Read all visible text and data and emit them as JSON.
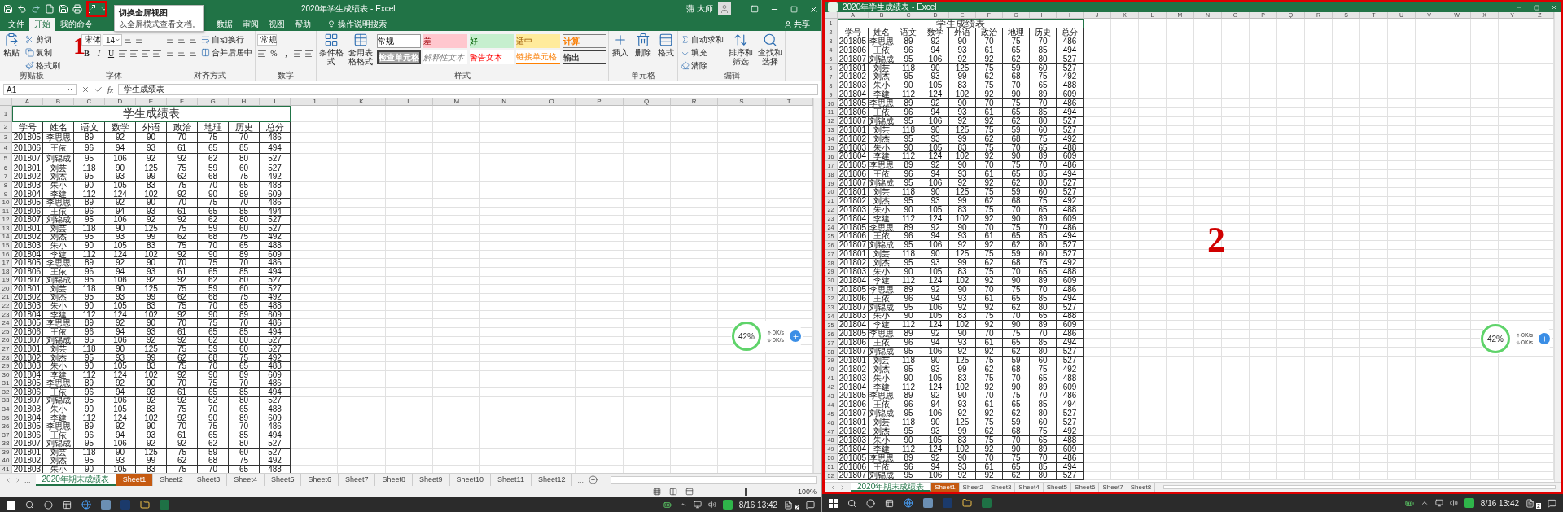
{
  "left_window": {
    "title": "2020年学生成绩表 - Excel",
    "user": "蒲 大师",
    "ribbon_tabs": [
      {
        "label": "文件",
        "selected": false
      },
      {
        "label": "开始",
        "selected": true
      },
      {
        "label": "我的命令",
        "selected": false
      },
      {
        "label": "数据",
        "selected": false
      },
      {
        "label": "审阅",
        "selected": false
      },
      {
        "label": "视图",
        "selected": false
      },
      {
        "label": "帮助",
        "selected": false
      }
    ],
    "tell_me": "操作说明搜索",
    "share": "共享",
    "tooltip": {
      "title": "切换全屏视图",
      "text": "以全屏模式查看文档。"
    },
    "ribbon_groups": [
      {
        "label": "剪贴板",
        "large": [
          {
            "kind": "large",
            "label": "粘贴"
          }
        ],
        "lines": [
          [
            {
              "kind": "small",
              "label": "剪切"
            }
          ],
          [
            {
              "kind": "small",
              "label": "复制"
            }
          ],
          [
            {
              "kind": "small",
              "label": "格式刷"
            }
          ]
        ]
      },
      {
        "label": "字体",
        "lines": [
          [
            {
              "kind": "select",
              "label": "宋体"
            },
            {
              "kind": "select",
              "label": "14"
            },
            {
              "kind": "icon"
            },
            {
              "kind": "icon"
            }
          ],
          [
            {
              "kind": "bold",
              "label": "B"
            },
            {
              "kind": "italic",
              "label": "I"
            },
            {
              "kind": "underline",
              "label": "U"
            },
            {
              "kind": "icon"
            },
            {
              "kind": "icon"
            },
            {
              "kind": "icon"
            },
            {
              "kind": "icon"
            }
          ]
        ]
      },
      {
        "label": "对齐方式",
        "lines": [
          [
            {
              "kind": "icon"
            },
            {
              "kind": "icon"
            },
            {
              "kind": "icon"
            },
            {
              "kind": "small",
              "label": "自动换行"
            }
          ],
          [
            {
              "kind": "icon"
            },
            {
              "kind": "icon"
            },
            {
              "kind": "icon"
            },
            {
              "kind": "small",
              "label": "合并后居中"
            }
          ]
        ]
      },
      {
        "label": "数字",
        "lines": [
          [
            {
              "kind": "select",
              "label": "常规"
            }
          ],
          [
            {
              "kind": "icon"
            },
            {
              "kind": "char",
              "label": "%"
            },
            {
              "kind": "char",
              "label": ","
            },
            {
              "kind": "icon"
            },
            {
              "kind": "icon"
            }
          ]
        ]
      },
      {
        "label": "样式",
        "large": [
          {
            "kind": "large",
            "label": "条件格式"
          },
          {
            "kind": "large",
            "label": "套用表格格式"
          }
        ],
        "styles": [
          {
            "kind": "normal",
            "label": "常规"
          },
          {
            "kind": "bad",
            "label": "差"
          },
          {
            "kind": "good",
            "label": "好"
          },
          {
            "kind": "neutral",
            "label": "适中"
          },
          {
            "kind": "calc",
            "label": "计算"
          },
          {
            "kind": "check",
            "label": "检查单元格"
          },
          {
            "kind": "explanatory",
            "label": "解释性文本"
          },
          {
            "kind": "warning",
            "label": "警告文本"
          },
          {
            "kind": "linked",
            "label": "链接单元格"
          },
          {
            "kind": "output",
            "label": "输出"
          }
        ]
      },
      {
        "label": "单元格",
        "large": [
          {
            "kind": "large",
            "label": "插入"
          },
          {
            "kind": "large",
            "label": "删除"
          },
          {
            "kind": "large",
            "label": "格式"
          }
        ]
      },
      {
        "label": "编辑",
        "lines": [
          [
            {
              "kind": "small",
              "label": "自动求和"
            }
          ],
          [
            {
              "kind": "small",
              "label": "填充"
            }
          ],
          [
            {
              "kind": "small",
              "label": "清除"
            }
          ]
        ],
        "large_after": [
          {
            "kind": "large",
            "label": "排序和筛选"
          },
          {
            "kind": "large",
            "label": "查找和选择"
          }
        ]
      }
    ],
    "name_box": "A1",
    "fx": "fx",
    "formula": "学生成绩表",
    "sheet": {
      "columns": [
        "A",
        "B",
        "C",
        "D",
        "E",
        "F",
        "G",
        "H",
        "I",
        "J",
        "K",
        "L",
        "M",
        "N",
        "O",
        "P",
        "Q",
        "R",
        "S",
        "T"
      ],
      "row_numbers": [
        "1",
        "2",
        "3",
        "4",
        "5",
        "6",
        "7",
        "8",
        "9",
        "10",
        "11",
        "12",
        "13",
        "14",
        "15",
        "16",
        "17",
        "18",
        "19",
        "20",
        "21",
        "22",
        "23",
        "24",
        "25",
        "26",
        "27",
        "28",
        "29",
        "30",
        "31",
        "32",
        "33",
        "34",
        "35",
        "36",
        "37",
        "38",
        "39",
        "40",
        "41"
      ],
      "title": "学生成绩表",
      "header": [
        "学号",
        "姓名",
        "语文",
        "数学",
        "外语",
        "政治",
        "地理",
        "历史",
        "总分"
      ],
      "rows": [
        [
          "201805",
          "李思思",
          "89",
          "92",
          "90",
          "70",
          "75",
          "70",
          "486"
        ],
        [
          "201806",
          "王依",
          "96",
          "94",
          "93",
          "61",
          "65",
          "85",
          "494"
        ],
        [
          "201807",
          "刘锦成",
          "95",
          "106",
          "92",
          "92",
          "62",
          "80",
          "527"
        ],
        [
          "201801",
          "刘芸",
          "118",
          "90",
          "125",
          "75",
          "59",
          "60",
          "527"
        ],
        [
          "201802",
          "刘杰",
          "95",
          "93",
          "99",
          "62",
          "68",
          "75",
          "492"
        ],
        [
          "201803",
          "朱小",
          "90",
          "105",
          "83",
          "75",
          "70",
          "65",
          "488"
        ],
        [
          "201804",
          "李建",
          "112",
          "124",
          "102",
          "92",
          "90",
          "89",
          "609"
        ],
        [
          "201805",
          "李思思",
          "89",
          "92",
          "90",
          "70",
          "75",
          "70",
          "486"
        ],
        [
          "201806",
          "王依",
          "96",
          "94",
          "93",
          "61",
          "65",
          "85",
          "494"
        ],
        [
          "201807",
          "刘锦成",
          "95",
          "106",
          "92",
          "92",
          "62",
          "80",
          "527"
        ],
        [
          "201801",
          "刘芸",
          "118",
          "90",
          "125",
          "75",
          "59",
          "60",
          "527"
        ],
        [
          "201802",
          "刘杰",
          "95",
          "93",
          "99",
          "62",
          "68",
          "75",
          "492"
        ],
        [
          "201803",
          "朱小",
          "90",
          "105",
          "83",
          "75",
          "70",
          "65",
          "488"
        ],
        [
          "201804",
          "李建",
          "112",
          "124",
          "102",
          "92",
          "90",
          "89",
          "609"
        ],
        [
          "201805",
          "李思思",
          "89",
          "92",
          "90",
          "70",
          "75",
          "70",
          "486"
        ],
        [
          "201806",
          "王依",
          "96",
          "94",
          "93",
          "61",
          "65",
          "85",
          "494"
        ],
        [
          "201807",
          "刘锦成",
          "95",
          "106",
          "92",
          "92",
          "62",
          "80",
          "527"
        ],
        [
          "201801",
          "刘芸",
          "118",
          "90",
          "125",
          "75",
          "59",
          "60",
          "527"
        ],
        [
          "201802",
          "刘杰",
          "95",
          "93",
          "99",
          "62",
          "68",
          "75",
          "492"
        ],
        [
          "201803",
          "朱小",
          "90",
          "105",
          "83",
          "75",
          "70",
          "65",
          "488"
        ],
        [
          "201804",
          "李建",
          "112",
          "124",
          "102",
          "92",
          "90",
          "89",
          "609"
        ],
        [
          "201805",
          "李思思",
          "89",
          "92",
          "90",
          "70",
          "75",
          "70",
          "486"
        ],
        [
          "201806",
          "王依",
          "96",
          "94",
          "93",
          "61",
          "65",
          "85",
          "494"
        ],
        [
          "201807",
          "刘锦成",
          "95",
          "106",
          "92",
          "92",
          "62",
          "80",
          "527"
        ],
        [
          "201801",
          "刘芸",
          "118",
          "90",
          "125",
          "75",
          "59",
          "60",
          "527"
        ],
        [
          "201802",
          "刘杰",
          "95",
          "93",
          "99",
          "62",
          "68",
          "75",
          "492"
        ],
        [
          "201803",
          "朱小",
          "90",
          "105",
          "83",
          "75",
          "70",
          "65",
          "488"
        ],
        [
          "201804",
          "李建",
          "112",
          "124",
          "102",
          "92",
          "90",
          "89",
          "609"
        ],
        [
          "201805",
          "李思思",
          "89",
          "92",
          "90",
          "70",
          "75",
          "70",
          "486"
        ],
        [
          "201806",
          "王依",
          "96",
          "94",
          "93",
          "61",
          "65",
          "85",
          "494"
        ],
        [
          "201807",
          "刘锦成",
          "95",
          "106",
          "92",
          "92",
          "62",
          "80",
          "527"
        ],
        [
          "201803",
          "朱小",
          "90",
          "105",
          "83",
          "75",
          "70",
          "65",
          "488"
        ],
        [
          "201804",
          "李建",
          "112",
          "124",
          "102",
          "92",
          "90",
          "89",
          "609"
        ],
        [
          "201805",
          "李思思",
          "89",
          "92",
          "90",
          "70",
          "75",
          "70",
          "486"
        ],
        [
          "201806",
          "王依",
          "96",
          "94",
          "93",
          "61",
          "65",
          "85",
          "494"
        ],
        [
          "201807",
          "刘锦成",
          "95",
          "106",
          "92",
          "92",
          "62",
          "80",
          "527"
        ],
        [
          "201801",
          "刘芸",
          "118",
          "90",
          "125",
          "75",
          "59",
          "60",
          "527"
        ],
        [
          "201802",
          "刘杰",
          "95",
          "93",
          "99",
          "62",
          "68",
          "75",
          "492"
        ],
        [
          "201803",
          "朱小",
          "90",
          "105",
          "83",
          "75",
          "70",
          "65",
          "488"
        ]
      ]
    },
    "tabs_more": "...",
    "sheet_tabs": [
      {
        "label": "2020年期末成绩表",
        "selected": true
      },
      {
        "label": "Sheet1",
        "selected": false,
        "color": "#c55a11"
      },
      {
        "label": "Sheet2",
        "selected": false
      },
      {
        "label": "Sheet3",
        "selected": false
      },
      {
        "label": "Sheet4",
        "selected": false
      },
      {
        "label": "Sheet5",
        "selected": false
      },
      {
        "label": "Sheet6",
        "selected": false
      },
      {
        "label": "Sheet7",
        "selected": false
      },
      {
        "label": "Sheet8",
        "selected": false
      },
      {
        "label": "Sheet9",
        "selected": false
      },
      {
        "label": "Sheet10",
        "selected": false
      },
      {
        "label": "Sheet11",
        "selected": false
      },
      {
        "label": "Sheet12",
        "selected": false
      }
    ],
    "tabs_overflow": "...",
    "zoom": {
      "label": "100%",
      "level": 0.5
    },
    "speed_widget": {
      "percent": "42%",
      "upload": "0K/s",
      "download": "0K/s"
    },
    "annotation": {
      "number": "1"
    },
    "taskbar": {
      "time": "8/16 13:42",
      "notification_count": "2"
    }
  },
  "right_window": {
    "title": "2020年学生成绩表 - Excel",
    "sheet": {
      "columns": [
        "A",
        "B",
        "C",
        "D",
        "E",
        "F",
        "G",
        "H",
        "I",
        "J",
        "K",
        "L",
        "M",
        "N",
        "O",
        "P",
        "Q",
        "R",
        "S",
        "T",
        "U",
        "V",
        "W",
        "X",
        "Y",
        "Z"
      ],
      "row_numbers": [
        "1",
        "2",
        "3",
        "4",
        "5",
        "6",
        "7",
        "8",
        "9",
        "10",
        "11",
        "12",
        "13",
        "14",
        "15",
        "16",
        "17",
        "18",
        "19",
        "20",
        "21",
        "22",
        "23",
        "24",
        "25",
        "26",
        "27",
        "28",
        "29",
        "30",
        "31",
        "32",
        "33",
        "34",
        "35",
        "36",
        "37",
        "38",
        "39",
        "40",
        "41",
        "42",
        "43",
        "44",
        "45",
        "46",
        "47",
        "48",
        "49",
        "50",
        "51",
        "52"
      ],
      "title": "学生成绩表",
      "header": [
        "学号",
        "姓名",
        "语文",
        "数学",
        "外语",
        "政治",
        "地理",
        "历史",
        "总分"
      ],
      "rows": [
        [
          "201805",
          "李思思",
          "89",
          "92",
          "90",
          "70",
          "75",
          "70",
          "486"
        ],
        [
          "201806",
          "王依",
          "96",
          "94",
          "93",
          "61",
          "65",
          "85",
          "494"
        ],
        [
          "201807",
          "刘锦成",
          "95",
          "106",
          "92",
          "92",
          "62",
          "80",
          "527"
        ],
        [
          "201801",
          "刘芸",
          "118",
          "90",
          "125",
          "75",
          "59",
          "60",
          "527"
        ],
        [
          "201802",
          "刘杰",
          "95",
          "93",
          "99",
          "62",
          "68",
          "75",
          "492"
        ],
        [
          "201803",
          "朱小",
          "90",
          "105",
          "83",
          "75",
          "70",
          "65",
          "488"
        ],
        [
          "201804",
          "李建",
          "112",
          "124",
          "102",
          "92",
          "90",
          "89",
          "609"
        ],
        [
          "201805",
          "李思思",
          "89",
          "92",
          "90",
          "70",
          "75",
          "70",
          "486"
        ],
        [
          "201806",
          "王依",
          "96",
          "94",
          "93",
          "61",
          "65",
          "85",
          "494"
        ],
        [
          "201807",
          "刘锦成",
          "95",
          "106",
          "92",
          "92",
          "62",
          "80",
          "527"
        ],
        [
          "201801",
          "刘芸",
          "118",
          "90",
          "125",
          "75",
          "59",
          "60",
          "527"
        ],
        [
          "201802",
          "刘杰",
          "95",
          "93",
          "99",
          "62",
          "68",
          "75",
          "492"
        ],
        [
          "201803",
          "朱小",
          "90",
          "105",
          "83",
          "75",
          "70",
          "65",
          "488"
        ],
        [
          "201804",
          "李建",
          "112",
          "124",
          "102",
          "92",
          "90",
          "89",
          "609"
        ],
        [
          "201805",
          "李思思",
          "89",
          "92",
          "90",
          "70",
          "75",
          "70",
          "486"
        ],
        [
          "201806",
          "王依",
          "96",
          "94",
          "93",
          "61",
          "65",
          "85",
          "494"
        ],
        [
          "201807",
          "刘锦成",
          "95",
          "106",
          "92",
          "92",
          "62",
          "80",
          "527"
        ],
        [
          "201801",
          "刘芸",
          "118",
          "90",
          "125",
          "75",
          "59",
          "60",
          "527"
        ],
        [
          "201802",
          "刘杰",
          "95",
          "93",
          "99",
          "62",
          "68",
          "75",
          "492"
        ],
        [
          "201803",
          "朱小",
          "90",
          "105",
          "83",
          "75",
          "70",
          "65",
          "488"
        ],
        [
          "201804",
          "李建",
          "112",
          "124",
          "102",
          "92",
          "90",
          "89",
          "609"
        ],
        [
          "201805",
          "李思思",
          "89",
          "92",
          "90",
          "70",
          "75",
          "70",
          "486"
        ],
        [
          "201806",
          "王依",
          "96",
          "94",
          "93",
          "61",
          "65",
          "85",
          "494"
        ],
        [
          "201807",
          "刘锦成",
          "95",
          "106",
          "92",
          "92",
          "62",
          "80",
          "527"
        ],
        [
          "201801",
          "刘芸",
          "118",
          "90",
          "125",
          "75",
          "59",
          "60",
          "527"
        ],
        [
          "201802",
          "刘杰",
          "95",
          "93",
          "99",
          "62",
          "68",
          "75",
          "492"
        ],
        [
          "201803",
          "朱小",
          "90",
          "105",
          "83",
          "75",
          "70",
          "65",
          "488"
        ],
        [
          "201804",
          "李建",
          "112",
          "124",
          "102",
          "92",
          "90",
          "89",
          "609"
        ],
        [
          "201805",
          "李思思",
          "89",
          "92",
          "90",
          "70",
          "75",
          "70",
          "486"
        ],
        [
          "201806",
          "王依",
          "96",
          "94",
          "93",
          "61",
          "65",
          "85",
          "494"
        ],
        [
          "201807",
          "刘锦成",
          "95",
          "106",
          "92",
          "92",
          "62",
          "80",
          "527"
        ],
        [
          "201803",
          "朱小",
          "90",
          "105",
          "83",
          "75",
          "70",
          "65",
          "488"
        ],
        [
          "201804",
          "李建",
          "112",
          "124",
          "102",
          "92",
          "90",
          "89",
          "609"
        ],
        [
          "201805",
          "李思思",
          "89",
          "92",
          "90",
          "70",
          "75",
          "70",
          "486"
        ],
        [
          "201806",
          "王依",
          "96",
          "94",
          "93",
          "61",
          "65",
          "85",
          "494"
        ],
        [
          "201807",
          "刘锦成",
          "95",
          "106",
          "92",
          "92",
          "62",
          "80",
          "527"
        ],
        [
          "201801",
          "刘芸",
          "118",
          "90",
          "125",
          "75",
          "59",
          "60",
          "527"
        ],
        [
          "201802",
          "刘杰",
          "95",
          "93",
          "99",
          "62",
          "68",
          "75",
          "492"
        ],
        [
          "201803",
          "朱小",
          "90",
          "105",
          "83",
          "75",
          "70",
          "65",
          "488"
        ],
        [
          "201804",
          "李建",
          "112",
          "124",
          "102",
          "92",
          "90",
          "89",
          "609"
        ],
        [
          "201805",
          "李思思",
          "89",
          "92",
          "90",
          "70",
          "75",
          "70",
          "486"
        ],
        [
          "201806",
          "王依",
          "96",
          "94",
          "93",
          "61",
          "65",
          "85",
          "494"
        ],
        [
          "201807",
          "刘锦成",
          "95",
          "106",
          "92",
          "92",
          "62",
          "80",
          "527"
        ],
        [
          "201801",
          "刘芸",
          "118",
          "90",
          "125",
          "75",
          "59",
          "60",
          "527"
        ],
        [
          "201802",
          "刘杰",
          "95",
          "93",
          "99",
          "62",
          "68",
          "75",
          "492"
        ],
        [
          "201803",
          "朱小",
          "90",
          "105",
          "83",
          "75",
          "70",
          "65",
          "488"
        ],
        [
          "201804",
          "李建",
          "112",
          "124",
          "102",
          "92",
          "90",
          "89",
          "609"
        ],
        [
          "201805",
          "李思思",
          "89",
          "92",
          "90",
          "70",
          "75",
          "70",
          "486"
        ],
        [
          "201806",
          "王依",
          "96",
          "94",
          "93",
          "61",
          "65",
          "85",
          "494"
        ],
        [
          "201807",
          "刘锦成",
          "95",
          "106",
          "92",
          "92",
          "62",
          "80",
          "527"
        ]
      ]
    },
    "sheet_tabs": [
      {
        "label": "2020年期末成绩表",
        "selected": true
      },
      {
        "label": "Sheet1",
        "selected": false,
        "color": "#c55a11"
      },
      {
        "label": "Sheet2",
        "selected": false
      },
      {
        "label": "Sheet3",
        "selected": false
      },
      {
        "label": "Sheet4",
        "selected": false
      },
      {
        "label": "Sheet5",
        "selected": false
      },
      {
        "label": "Sheet6",
        "selected": false
      },
      {
        "label": "Sheet7",
        "selected": false
      },
      {
        "label": "Sheet8",
        "selected": false
      }
    ],
    "speed_widget": {
      "percent": "42%",
      "upload": "0K/s",
      "download": "0K/s"
    },
    "annotation": {
      "number": "2"
    },
    "taskbar": {
      "time": "8/16 13:42",
      "notification_count": "2"
    }
  }
}
